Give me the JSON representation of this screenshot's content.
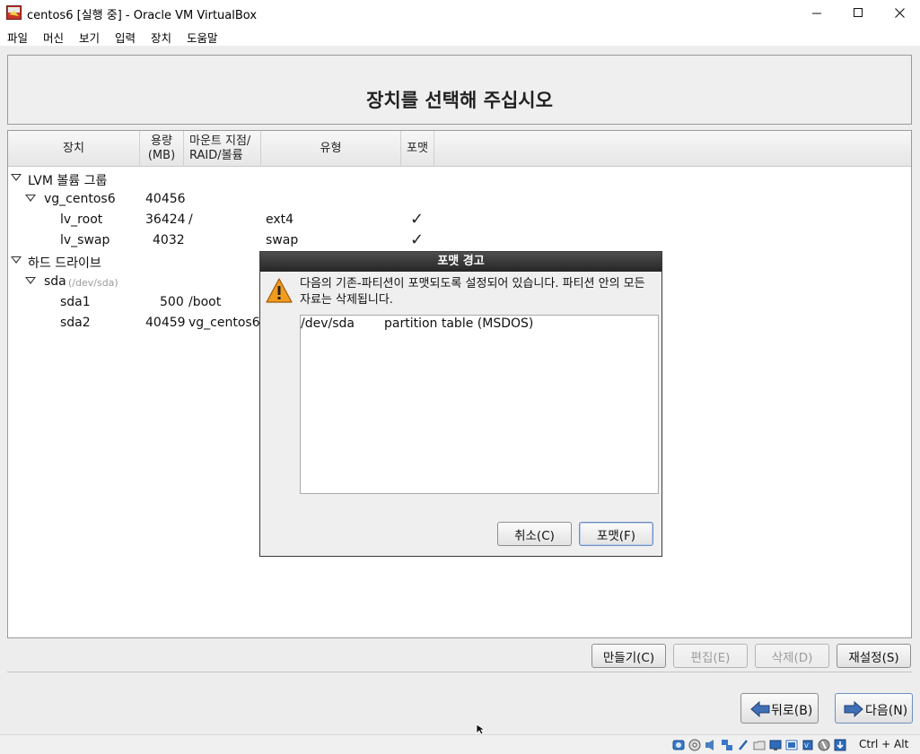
{
  "window": {
    "title": "centos6 [실행 중] - Oracle VM VirtualBox"
  },
  "menu": {
    "items": [
      "파일",
      "머신",
      "보기",
      "입력",
      "장치",
      "도움말"
    ]
  },
  "installer": {
    "title": "장치를 선택해 주십시오",
    "columns": {
      "device": "장치",
      "size": "용량\n(MB)",
      "mount": "마운트 지점/\nRAID/볼륨",
      "type": "유형",
      "format": "포맷"
    },
    "tree": [
      {
        "device": "LVM 볼륨 그룹",
        "level": 0,
        "expanded": true
      },
      {
        "device": "vg_centos6",
        "level": 1,
        "expanded": true,
        "size": "40456"
      },
      {
        "device": "lv_root",
        "level": 2,
        "size": "36424",
        "mount": "/",
        "type": "ext4",
        "format": true
      },
      {
        "device": "lv_swap",
        "level": 2,
        "size": "4032",
        "mount": "",
        "type": "swap",
        "format": true
      },
      {
        "device": "하드 드라이브",
        "level": 0,
        "expanded": true
      },
      {
        "device": "sda",
        "level": 1,
        "expanded": true,
        "path": "(/dev/sda)"
      },
      {
        "device": "sda1",
        "level": 2,
        "size": "500",
        "mount": "/boot"
      },
      {
        "device": "sda2",
        "level": 2,
        "size": "40459",
        "mount": "vg_centos6"
      }
    ],
    "actions": {
      "create": "만들기(C)",
      "edit": "편집(E)",
      "delete": "삭제(D)",
      "reset": "재설정(S)"
    },
    "nav": {
      "back": "뒤로(B)",
      "next": "다음(N)"
    }
  },
  "dialog": {
    "title": "포맷 경고",
    "message": "다음의 기존-파티션이 포맷되도록 설정되어 있습니다. 파티션 안의 모든 자료는 삭제됩니다.",
    "items": [
      {
        "device": "/dev/sda",
        "description": "partition table (MSDOS)"
      }
    ],
    "cancel": "취소(C)",
    "confirm": "포맷(F)"
  },
  "statusbar": {
    "hostkey": "Ctrl + Alt"
  }
}
